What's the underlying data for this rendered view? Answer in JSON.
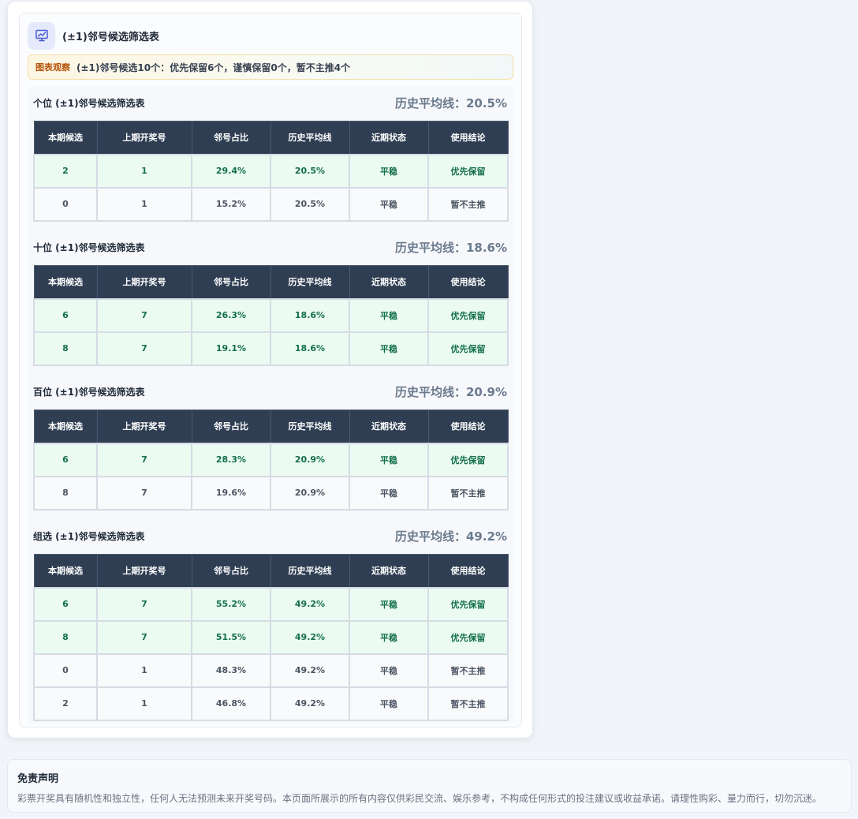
{
  "header": {
    "title": "(±1)邻号候选筛选表",
    "icon": "chart-icon"
  },
  "insight": {
    "tag": "图表观察",
    "text": "(±1)邻号候选10个：优先保留6个，谨慎保留0个，暂不主推4个"
  },
  "columns": [
    "本期候选",
    "上期开奖号",
    "邻号占比",
    "历史平均线",
    "近期状态",
    "使用结论"
  ],
  "sections": [
    {
      "title": "个位 (±1)邻号候选筛选表",
      "avg": "历史平均线：20.5%",
      "rows": [
        {
          "status": "good",
          "cells": [
            "2",
            "1",
            "29.4%",
            "20.5%",
            "平稳",
            "优先保留"
          ]
        },
        {
          "status": "neutral",
          "cells": [
            "0",
            "1",
            "15.2%",
            "20.5%",
            "平稳",
            "暂不主推"
          ]
        }
      ]
    },
    {
      "title": "十位 (±1)邻号候选筛选表",
      "avg": "历史平均线：18.6%",
      "rows": [
        {
          "status": "good",
          "cells": [
            "6",
            "7",
            "26.3%",
            "18.6%",
            "平稳",
            "优先保留"
          ]
        },
        {
          "status": "good",
          "cells": [
            "8",
            "7",
            "19.1%",
            "18.6%",
            "平稳",
            "优先保留"
          ]
        }
      ]
    },
    {
      "title": "百位 (±1)邻号候选筛选表",
      "avg": "历史平均线：20.9%",
      "rows": [
        {
          "status": "good",
          "cells": [
            "6",
            "7",
            "28.3%",
            "20.9%",
            "平稳",
            "优先保留"
          ]
        },
        {
          "status": "neutral",
          "cells": [
            "8",
            "7",
            "19.6%",
            "20.9%",
            "平稳",
            "暂不主推"
          ]
        }
      ]
    },
    {
      "title": "组选 (±1)邻号候选筛选表",
      "avg": "历史平均线：49.2%",
      "rows": [
        {
          "status": "good",
          "cells": [
            "6",
            "7",
            "55.2%",
            "49.2%",
            "平稳",
            "优先保留"
          ]
        },
        {
          "status": "good",
          "cells": [
            "8",
            "7",
            "51.5%",
            "49.2%",
            "平稳",
            "优先保留"
          ]
        },
        {
          "status": "neutral",
          "cells": [
            "0",
            "1",
            "48.3%",
            "49.2%",
            "平稳",
            "暂不主推"
          ]
        },
        {
          "status": "neutral",
          "cells": [
            "2",
            "1",
            "46.8%",
            "49.2%",
            "平稳",
            "暂不主推"
          ]
        }
      ]
    }
  ],
  "disclaimer": {
    "title": "免责声明",
    "text": "彩票开奖具有随机性和独立性，任何人无法预测未来开奖号码。本页面所展示的所有内容仅供彩民交流、娱乐参考，不构成任何形式的投注建议或收益承诺。请理性购彩、量力而行，切勿沉迷。"
  },
  "colors": {
    "table_header": "#2f3e52",
    "good_row_bg": "#ebfbf2",
    "good_row_text": "#15704a",
    "insight_tag": "#b45309"
  }
}
